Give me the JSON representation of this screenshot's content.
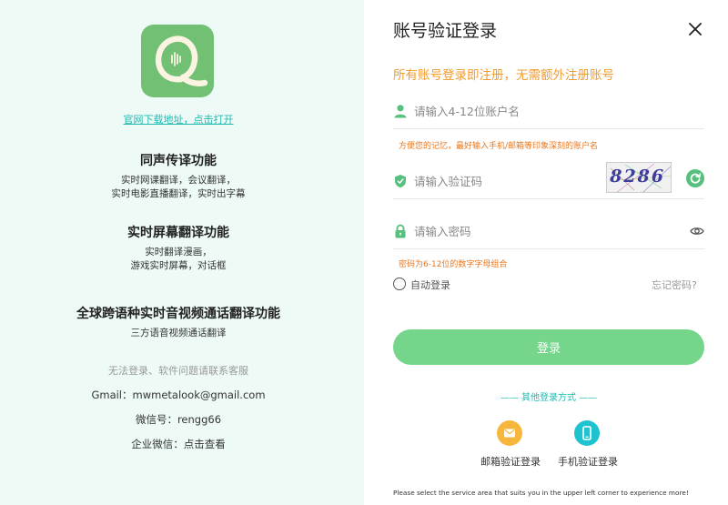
{
  "left": {
    "download_link": "官网下载地址，点击打开",
    "features": [
      {
        "title": "同声传译功能",
        "lines": [
          "实时网课翻译，会议翻译，",
          "实时电影直播翻译，实时出字幕"
        ]
      },
      {
        "title": "实时屏幕翻译功能",
        "lines": [
          "实时翻译漫画，",
          "游戏实时屏幕，对话框"
        ]
      },
      {
        "title": "全球跨语种实时音视频通话翻译功能",
        "lines": [
          "三方语音视频通话翻译"
        ]
      }
    ],
    "contact": {
      "hint": "无法登录、软件问题请联系客服",
      "email": "Gmail：mwmetalook@gmail.com",
      "wechat": "微信号：rengg66",
      "work_wechat": "企业微信：点击查看"
    }
  },
  "right": {
    "title": "账号验证登录",
    "subtitle": "所有账号登录即注册，无需额外注册账号",
    "username": {
      "placeholder": "请输入4-12位账户名",
      "value": "",
      "hint": "方便您的记忆，最好输入手机/邮箱等印象深刻的账户名"
    },
    "captcha": {
      "placeholder": "请输入验证码",
      "value": "",
      "image_text": "8286"
    },
    "password": {
      "placeholder": "请输入密码",
      "value": "",
      "hint": "密码为6-12位的数字字母组合"
    },
    "remember_label": "自动登录",
    "forgot_label": "忘记密码?",
    "login_button": "登录",
    "other_methods": "—— 其他登录方式 ——",
    "email_login": "邮箱验证登录",
    "phone_login": "手机验证登录",
    "footer": "Please select the service area that suits you in the upper left corner to experience more!"
  },
  "colors": {
    "accent_green": "#75d58b",
    "brand_green": "#72c073",
    "teal": "#1fb9b0",
    "orange": "#f39b2e",
    "email_icon": "#f6b73c",
    "phone_icon": "#1fc3cf"
  },
  "icons": [
    "app-logo",
    "close-icon",
    "user-icon",
    "shield-icon",
    "refresh-icon",
    "lock-icon",
    "eye-icon",
    "mail-icon",
    "phone-icon"
  ]
}
